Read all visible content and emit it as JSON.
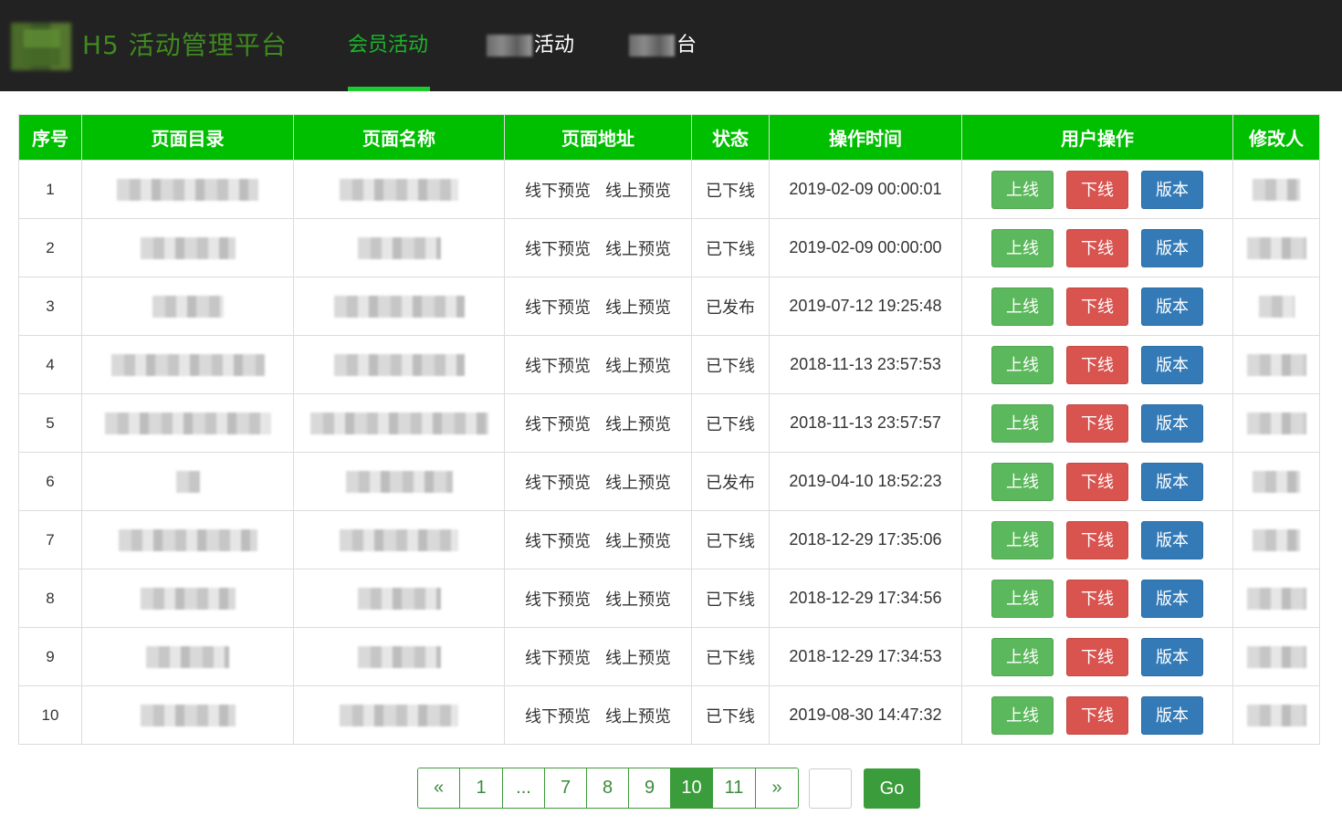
{
  "header": {
    "brand": "H5 活动管理平台",
    "nav": [
      {
        "label": "会员活动",
        "active": true
      },
      {
        "label": "活动",
        "active": false
      },
      {
        "label": "台",
        "active": false
      }
    ]
  },
  "table": {
    "columns": [
      "序号",
      "页面目录",
      "页面名称",
      "页面地址",
      "状态",
      "操作时间",
      "用户操作",
      "修改人"
    ],
    "offline_preview": "线下预览",
    "online_preview": "线上预览",
    "btn_online": "上线",
    "btn_offline": "下线",
    "btn_version": "版本",
    "rows": [
      {
        "idx": "1",
        "status": "已下线",
        "time": "2019-02-09 00:00:01"
      },
      {
        "idx": "2",
        "status": "已下线",
        "time": "2019-02-09 00:00:00"
      },
      {
        "idx": "3",
        "status": "已发布",
        "time": "2019-07-12 19:25:48"
      },
      {
        "idx": "4",
        "status": "已下线",
        "time": "2018-11-13 23:57:53"
      },
      {
        "idx": "5",
        "status": "已下线",
        "time": "2018-11-13 23:57:57"
      },
      {
        "idx": "6",
        "status": "已发布",
        "time": "2019-04-10 18:52:23"
      },
      {
        "idx": "7",
        "status": "已下线",
        "time": "2018-12-29 17:35:06"
      },
      {
        "idx": "8",
        "status": "已下线",
        "time": "2018-12-29 17:34:56"
      },
      {
        "idx": "9",
        "status": "已下线",
        "time": "2018-12-29 17:34:53"
      },
      {
        "idx": "10",
        "status": "已下线",
        "time": "2019-08-30 14:47:32"
      }
    ]
  },
  "pagination": {
    "pages": [
      "«",
      "1",
      "...",
      "7",
      "8",
      "9",
      "10",
      "11",
      "»"
    ],
    "current": "10",
    "go_label": "Go"
  },
  "colors": {
    "header_bg": "#222222",
    "accent_green": "#00bf00",
    "btn_online": "#5cb85c",
    "btn_offline": "#d9534f",
    "btn_version": "#337ab7"
  }
}
